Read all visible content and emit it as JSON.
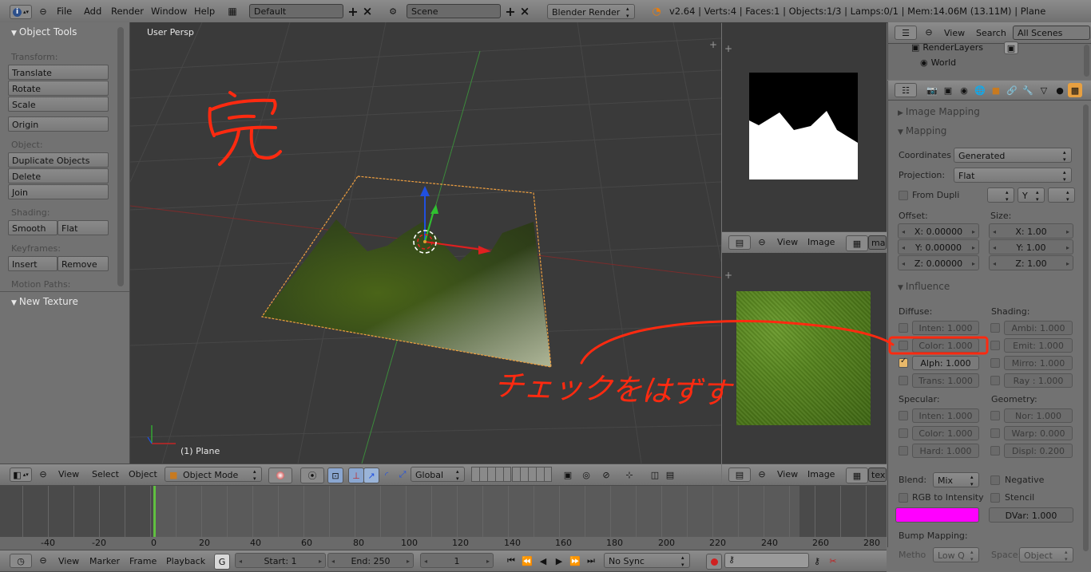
{
  "top_menu": {
    "items": [
      "File",
      "Add",
      "Render",
      "Window",
      "Help"
    ],
    "layout": "Default",
    "scene": "Scene",
    "engine": "Blender Render",
    "stats": "v2.64 | Verts:4 | Faces:1 | Objects:1/3 | Lamps:0/1 | Mem:14.06M (13.11M) | Plane"
  },
  "tool_shelf": {
    "title": "Object Tools",
    "transform_label": "Transform:",
    "translate": "Translate",
    "rotate": "Rotate",
    "scale": "Scale",
    "origin": "Origin",
    "object_label": "Object:",
    "duplicate": "Duplicate Objects",
    "delete": "Delete",
    "join": "Join",
    "shading_label": "Shading:",
    "smooth": "Smooth",
    "flat": "Flat",
    "keyframes_label": "Keyframes:",
    "insert": "Insert",
    "remove": "Remove",
    "motion_paths_label": "Motion Paths:",
    "new_texture": "New Texture"
  },
  "viewport": {
    "view_name": "User Persp",
    "object_name": "(1) Plane",
    "annotation_kanji": "完",
    "annotation_note": "チェックをはずす",
    "header": {
      "view": "View",
      "select": "Select",
      "object": "Object",
      "mode": "Object Mode",
      "orientation": "Global"
    }
  },
  "image_editor_top": {
    "view": "View",
    "image": "Image",
    "image_name": "mas"
  },
  "image_editor_bottom": {
    "view": "View",
    "image": "Image",
    "image_name": "tex"
  },
  "outliner": {
    "view": "View",
    "search": "Search",
    "scope": "All Scenes",
    "row1": "RenderLayers",
    "row2": "World"
  },
  "properties": {
    "image_mapping": "Image Mapping",
    "mapping": "Mapping",
    "coordinates_label": "Coordinates",
    "coordinates_value": "Generated",
    "projection_label": "Projection:",
    "projection_value": "Flat",
    "from_dupli": "From Dupli",
    "y_axis": "Y",
    "offset_label": "Offset:",
    "size_label": "Size:",
    "offset_x": "X: 0.00000",
    "offset_y": "Y: 0.00000",
    "offset_z": "Z: 0.00000",
    "size_x": "X: 1.00",
    "size_y": "Y: 1.00",
    "size_z": "Z: 1.00",
    "influence": "Influence",
    "diffuse_label": "Diffuse:",
    "shading_label": "Shading:",
    "inten": "Inten: 1.000",
    "color": "Color: 1.000",
    "alph": "Alph: 1.000",
    "trans": "Trans: 1.000",
    "ambi": "Ambi: 1.000",
    "emit": "Emit: 1.000",
    "mirro": "Mirro: 1.000",
    "ray": "Ray : 1.000",
    "specular_label": "Specular:",
    "geometry_label": "Geometry:",
    "spec_inten": "Inten: 1.000",
    "spec_color": "Color: 1.000",
    "hard": "Hard: 1.000",
    "nor": "Nor: 1.000",
    "warp": "Warp: 0.000",
    "displ": "Displ: 0.200",
    "blend_label": "Blend:",
    "blend_value": "Mix",
    "negative": "Negative",
    "rgb_to_intensity": "RGB to Intensity",
    "stencil": "Stencil",
    "dvar": "DVar: 1.000",
    "bump_mapping": "Bump Mapping:",
    "method_label": "Metho",
    "method_value": "Low Q",
    "space_label": "Space:",
    "space_value": "Object",
    "swatch_color": "#ff00ff"
  },
  "timeline": {
    "ticks": [
      "-40",
      "-20",
      "0",
      "20",
      "40",
      "60",
      "80",
      "100",
      "120",
      "140",
      "160",
      "180",
      "200",
      "220",
      "240",
      "260",
      "280"
    ],
    "view": "View",
    "marker": "Marker",
    "frame": "Frame",
    "playback": "Playback",
    "start": "Start: 1",
    "end": "End: 250",
    "current": "1",
    "sync": "No Sync"
  },
  "colors": {
    "annotation_red": "#ff2a10",
    "selection_orange": "#f0a040",
    "grass": "#4f7a1c"
  }
}
